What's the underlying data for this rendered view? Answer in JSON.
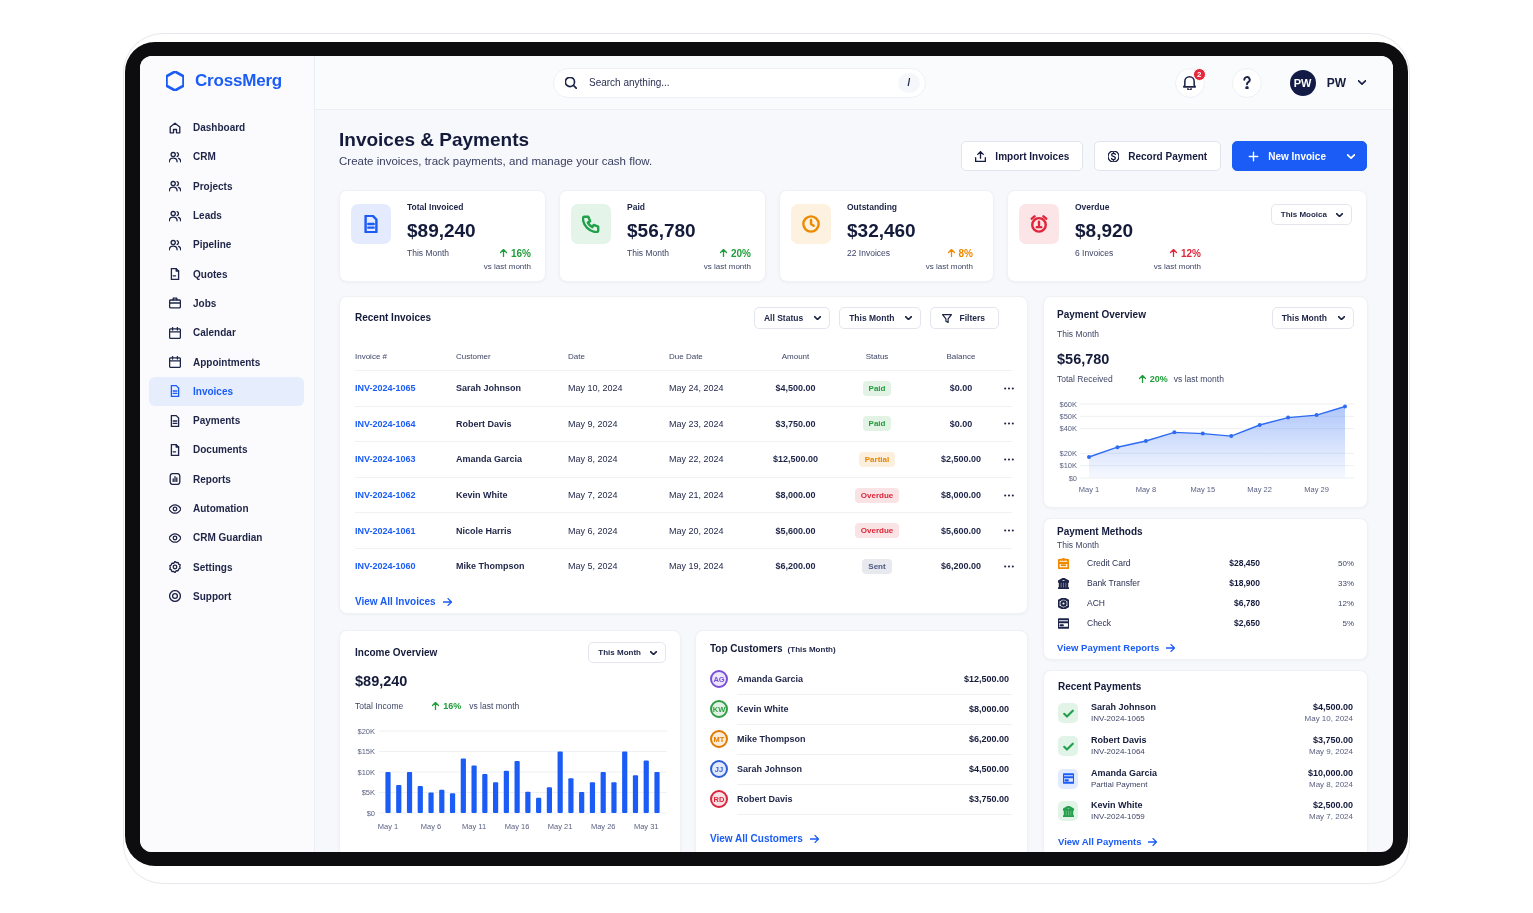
{
  "app": {
    "logo": "CrossMerg"
  },
  "sidebar": {
    "items": [
      {
        "label": "Dashboard",
        "selected": false
      },
      {
        "label": "CRM",
        "selected": false
      },
      {
        "label": "Projects",
        "selected": false
      },
      {
        "label": "Leads",
        "selected": false
      },
      {
        "label": "Pipeline",
        "selected": false
      },
      {
        "label": "Quotes",
        "selected": false
      },
      {
        "label": "Jobs",
        "selected": false
      },
      {
        "label": "Calendar",
        "selected": false
      },
      {
        "label": "Appointments",
        "selected": false
      },
      {
        "label": "Invoices",
        "selected": true
      },
      {
        "label": "Payments",
        "selected": false
      },
      {
        "label": "Documents",
        "selected": false
      },
      {
        "label": "Reports",
        "selected": false
      },
      {
        "label": "Automation",
        "selected": false
      },
      {
        "label": "CRM Guardian",
        "selected": false
      },
      {
        "label": "Settings",
        "selected": false
      },
      {
        "label": "Support",
        "selected": false
      }
    ]
  },
  "header": {
    "search": {
      "placeholder": "Search anything...",
      "shortcut": "/"
    },
    "notifications": "2",
    "user": {
      "initials": "PW",
      "name": "PW"
    }
  },
  "page": {
    "title": "Invoices & Payments",
    "subtitle": "Create invoices, track payments, and manage your cash flow.",
    "actions": [
      {
        "label": "Import Invoices",
        "kind": "secondary"
      },
      {
        "label": "Record Payment",
        "kind": "secondary"
      },
      {
        "label": "New Invoice",
        "kind": "primary"
      }
    ]
  },
  "stats": [
    {
      "label": "Total Invoiced",
      "value": "$89,240",
      "note": "This Month",
      "change": {
        "value": "16%",
        "color": "#1f9d3a"
      },
      "comparison": "vs last month",
      "color": "#1a5cf5"
    },
    {
      "label": "Paid",
      "value": "$56,780",
      "note": "This Month",
      "change": {
        "value": "20%",
        "color": "#1f9d3a"
      },
      "comparison": "vs last month",
      "color": "#22a04b"
    },
    {
      "label": "Outstanding",
      "value": "$32,460",
      "note": "22 Invoices",
      "change": {
        "value": "8%",
        "color": "#ee8a00"
      },
      "comparison": "vs last month",
      "color": "#ee8a00"
    },
    {
      "label": "Overdue",
      "value": "$8,920",
      "note": "6 Invoices",
      "change": {
        "value": "12%",
        "color": "#e0263a"
      },
      "comparison": "vs last month",
      "color": "#e0263a",
      "filter": "This Mooica"
    }
  ],
  "recent_invoices": {
    "title": "Recent Invoices",
    "controls": [
      {
        "label": "All Status",
        "kind": "select"
      },
      {
        "label": "This Month",
        "kind": "select"
      },
      {
        "label": "Filters",
        "kind": "button"
      }
    ],
    "columns": [
      "Invoice #",
      "Customer",
      "Date",
      "Due Date",
      "Amount",
      "Status",
      "Balance"
    ],
    "rows": [
      {
        "invoice": "INV-2024-1065",
        "customer": "Sarah Johnson",
        "date": "May 10, 2024",
        "due_date": "May 24, 2024",
        "amount": "$4,500.00",
        "status": {
          "label": "Paid",
          "color": "#1f9d3a"
        },
        "balance": "$0.00"
      },
      {
        "invoice": "INV-2024-1064",
        "customer": "Robert Davis",
        "date": "May 9, 2024",
        "due_date": "May 23, 2024",
        "amount": "$3,750.00",
        "status": {
          "label": "Paid",
          "color": "#1f9d3a"
        },
        "balance": "$0.00"
      },
      {
        "invoice": "INV-2024-1063",
        "customer": "Amanda Garcia",
        "date": "May 8, 2024",
        "due_date": "May 22, 2024",
        "amount": "$12,500.00",
        "status": {
          "label": "Partial",
          "color": "#e58600"
        },
        "balance": "$2,500.00"
      },
      {
        "invoice": "INV-2024-1062",
        "customer": "Kevin White",
        "date": "May 7, 2024",
        "due_date": "May 21, 2024",
        "amount": "$8,000.00",
        "status": {
          "label": "Overdue",
          "color": "#dc2639"
        },
        "balance": "$8,000.00"
      },
      {
        "invoice": "INV-2024-1061",
        "customer": "Nicole Harris",
        "date": "May 6, 2024",
        "due_date": "May 20, 2024",
        "amount": "$5,600.00",
        "status": {
          "label": "Overdue",
          "color": "#dc2639"
        },
        "balance": "$5,600.00"
      },
      {
        "invoice": "INV-2024-1060",
        "customer": "Mike Thompson",
        "date": "May 5, 2024",
        "due_date": "May 19, 2024",
        "amount": "$6,200.00",
        "status": {
          "label": "Sent",
          "color": "#4a5580"
        },
        "balance": "$6,200.00"
      }
    ],
    "link": "View All Invoices"
  },
  "payment_overview": {
    "title": "Payment Overview",
    "period": "This Month",
    "subtitle": "This Month",
    "total": "$56,780",
    "total_label": "Total Received",
    "change": "20%",
    "comparison": "vs last month",
    "chart_data": {
      "type": "area",
      "categories": [
        "May 1",
        null,
        "May 8",
        null,
        "May 15",
        null,
        "May 22",
        null,
        "May 29",
        null
      ],
      "series": [
        {
          "color": "#2f6bf2",
          "values": [
            17000,
            25000,
            30000,
            37000,
            36000,
            34000,
            43000,
            49000,
            51000,
            58000
          ]
        }
      ],
      "ylim": [
        0,
        60000
      ],
      "yticks": [
        {
          "value": 0,
          "label": "$0"
        },
        {
          "value": 10000,
          "label": "$10K"
        },
        {
          "value": 20000,
          "label": "$20K"
        },
        {
          "value": 40000,
          "label": "$40K"
        },
        {
          "value": 50000,
          "label": "$50K"
        },
        {
          "value": 60000,
          "label": "$60K"
        }
      ],
      "grid": true
    }
  },
  "income_overview": {
    "title": "Income Overview",
    "period": "This Month",
    "total": "$89,240",
    "total_label": "Total Income",
    "change": "16%",
    "comparison": "vs last month",
    "chart_data": {
      "type": "bar",
      "categories": [
        "May 1",
        null,
        null,
        null,
        "May 6",
        null,
        null,
        null,
        "May 11",
        null,
        null,
        null,
        "May 16",
        null,
        null,
        null,
        "May 21",
        null,
        null,
        null,
        "May 26",
        null,
        null,
        null,
        "May 31",
        null
      ],
      "series": [
        {
          "color": "#1a5cf5",
          "values": [
            10000,
            6800,
            10000,
            6600,
            5000,
            5700,
            4800,
            13300,
            11600,
            9500,
            7500,
            10300,
            12700,
            5200,
            3700,
            6300,
            15000,
            8500,
            5100,
            7500,
            10000,
            7500,
            15000,
            9200,
            12800,
            10000
          ]
        }
      ],
      "ylim": [
        0,
        20000
      ],
      "yticks": [
        {
          "value": 0,
          "label": "$0"
        },
        {
          "value": 5000,
          "label": "$5K"
        },
        {
          "value": 10000,
          "label": "$10K"
        },
        {
          "value": 15000,
          "label": "$15K"
        },
        {
          "value": 20000,
          "label": "$20K"
        }
      ],
      "grid": true
    }
  },
  "top_customers": {
    "title": "Top Customers",
    "period": "(This Month)",
    "items": [
      {
        "initials": "AG",
        "name": "Amanda Garcia",
        "amount": "$12,500.00",
        "color": "#7a4fd8"
      },
      {
        "initials": "KW",
        "name": "Kevin White",
        "amount": "$8,000.00",
        "color": "#2f9e44"
      },
      {
        "initials": "MT",
        "name": "Mike Thompson",
        "amount": "$6,200.00",
        "color": "#e07b00"
      },
      {
        "initials": "JJ",
        "name": "Sarah Johnson",
        "amount": "$4,500.00",
        "color": "#2f5fd6"
      },
      {
        "initials": "RD",
        "name": "Robert Davis",
        "amount": "$3,750.00",
        "color": "#d9263c"
      }
    ],
    "link": "View All Customers"
  },
  "payment_methods": {
    "title": "Payment Methods",
    "subtitle": "This Month",
    "items": [
      {
        "name": "Credit Card",
        "amount": "$28,450",
        "share": "50%",
        "color": "#ee8a00"
      },
      {
        "name": "Bank Transfer",
        "amount": "$18,900",
        "share": "33%",
        "color": "#1e2447"
      },
      {
        "name": "ACH",
        "amount": "$6,780",
        "share": "12%",
        "color": "#1e2447"
      },
      {
        "name": "Check",
        "amount": "$2,650",
        "share": "5%",
        "color": "#1e2447"
      }
    ],
    "link": "View Payment Reports"
  },
  "recent_payments": {
    "title": "Recent Payments",
    "items": [
      {
        "name": "Sarah Johnson",
        "reference": "INV-2024-1065",
        "amount": "$4,500.00",
        "date": "May 10, 2024",
        "color": "#22a04b"
      },
      {
        "name": "Robert Davis",
        "reference": "INV-2024-1064",
        "amount": "$3,750.00",
        "date": "May 9, 2024",
        "color": "#22a04b"
      },
      {
        "name": "Amanda Garcia",
        "reference": "Partial Payment",
        "amount": "$10,000.00",
        "date": "May 8, 2024",
        "color": "#1a5cf5"
      },
      {
        "name": "Kevin White",
        "reference": "INV-2024-1059",
        "amount": "$2,500.00",
        "date": "May 7, 2024",
        "color": "#22a04b"
      }
    ],
    "link": "View All Payments"
  }
}
